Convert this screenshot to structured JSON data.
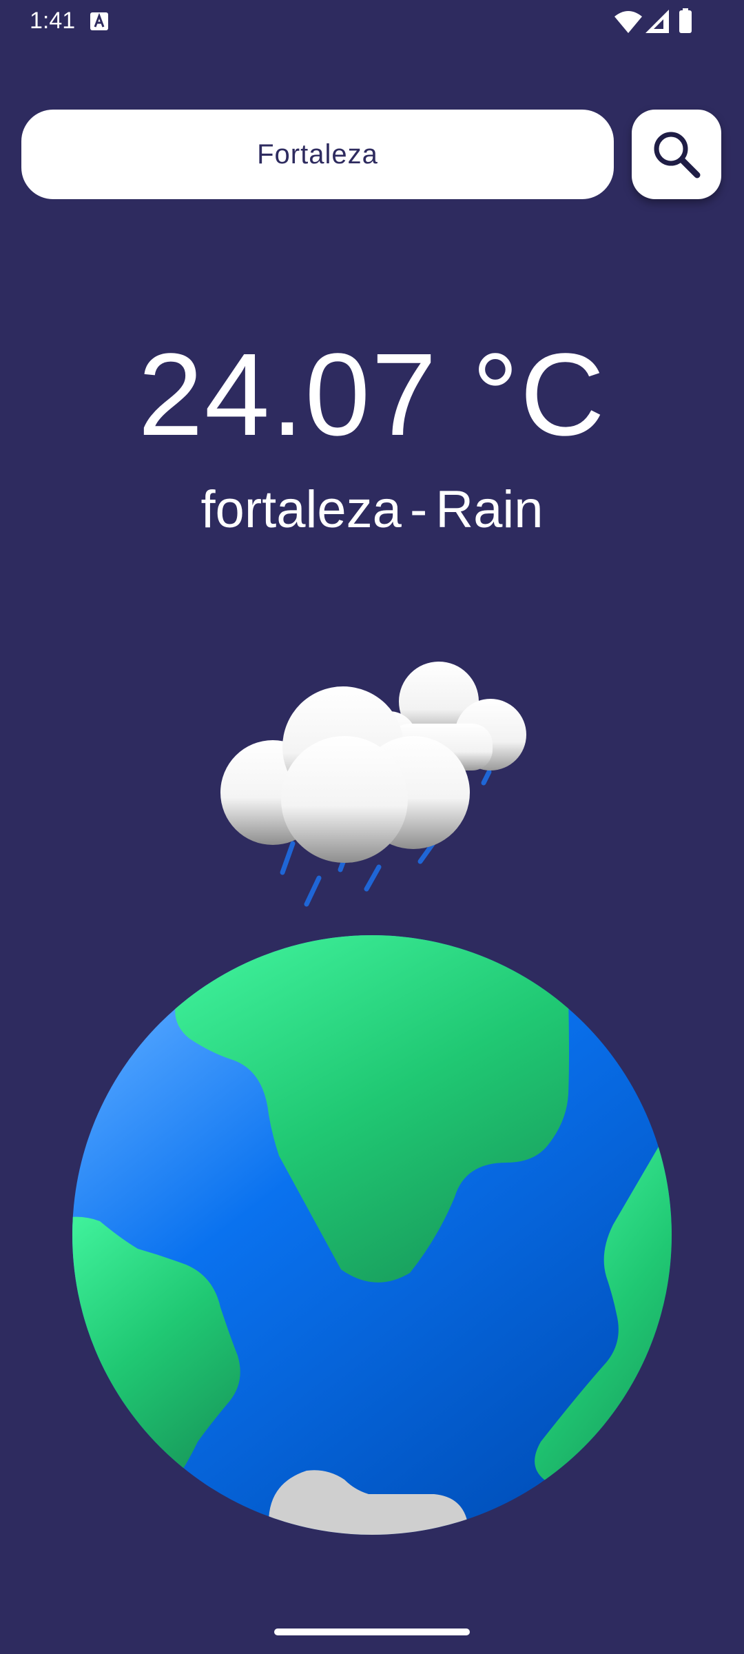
{
  "status_bar": {
    "time": "1:41",
    "icons": [
      "text-a-icon",
      "wifi-icon",
      "signal-icon",
      "battery-icon"
    ]
  },
  "search": {
    "value": "Fortaleza",
    "icon": "search-icon"
  },
  "weather": {
    "temperature": "24.07 °C",
    "location": "fortaleza",
    "separator": "-",
    "condition": "Rain",
    "illustration": "rain-cloud-icon"
  },
  "globe": {
    "illustration": "earth-globe-icon"
  },
  "colors": {
    "background": "#2e2b5f",
    "field_background": "#ffffff",
    "text": "#ffffff",
    "ocean": "#0a6ddc",
    "land": "#22c872",
    "rain": "#1f66d6"
  }
}
